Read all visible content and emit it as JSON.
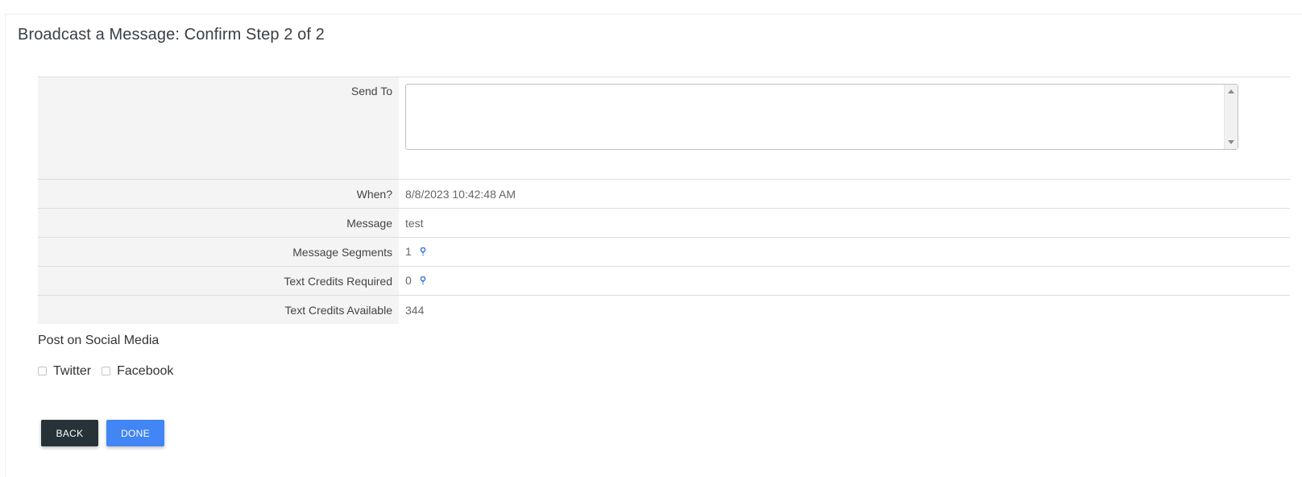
{
  "page": {
    "title": "Broadcast a Message: Confirm Step 2 of 2"
  },
  "form": {
    "send_to": {
      "label": "Send To",
      "value": ""
    },
    "when": {
      "label": "When?",
      "value": "8/8/2023 10:42:48 AM"
    },
    "message": {
      "label": "Message",
      "value": "test"
    },
    "segments": {
      "label": "Message Segments",
      "value": "1",
      "icon": "help-icon"
    },
    "credits_required": {
      "label": "Text Credits Required",
      "value": "0",
      "icon": "help-icon"
    },
    "credits_available": {
      "label": "Text Credits Available",
      "value": "344"
    }
  },
  "social": {
    "heading": "Post on Social Media",
    "options": [
      {
        "label": "Twitter",
        "checked": false
      },
      {
        "label": "Facebook",
        "checked": false
      }
    ]
  },
  "actions": {
    "back_label": "BACK",
    "done_label": "DONE"
  },
  "colors": {
    "back_button": "#263238",
    "done_button": "#4285f4",
    "help_icon": "#3b6fd8"
  }
}
